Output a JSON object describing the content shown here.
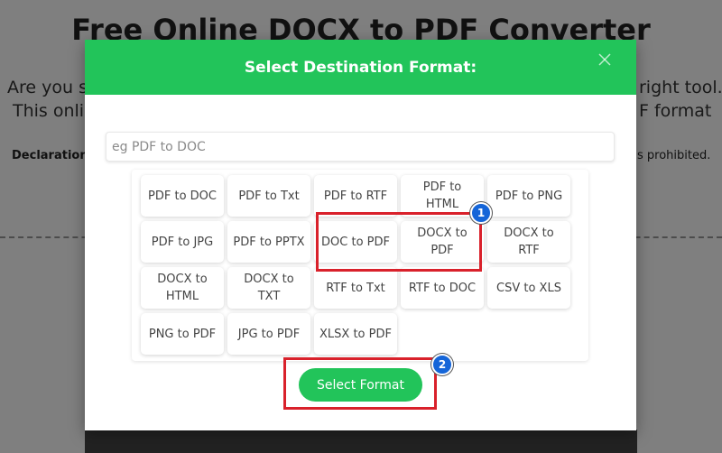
{
  "background": {
    "title": "Free Online DOCX to PDF Converter",
    "line1_left": "Are you s",
    "line1_right": "right tool.",
    "line2_left": "This onli",
    "line2_right": "F format",
    "declaration_label": "Declaration:",
    "declaration_right": "s prohibited."
  },
  "modal": {
    "title": "Select Destination Format:",
    "close_icon": "close-icon",
    "search": {
      "placeholder": "eg PDF to DOC",
      "value": ""
    },
    "formats": [
      "PDF to DOC",
      "PDF to Txt",
      "PDF to RTF",
      "PDF to HTML",
      "PDF to PNG",
      "PDF to JPG",
      "PDF to PPTX",
      "DOC to PDF",
      "DOCX to PDF",
      "DOCX to RTF",
      "DOCX to HTML",
      "DOCX to TXT",
      "RTF to Txt",
      "RTF to DOC",
      "CSV to XLS",
      "PNG to PDF",
      "JPG to PDF",
      "XLSX to PDF"
    ],
    "select_button_label": "Select Format"
  },
  "annotations": {
    "step1": "1",
    "step2": "2",
    "highlight_color": "#d9212b",
    "badge_color": "#1565d8"
  },
  "colors": {
    "accent": "#22c45a"
  }
}
